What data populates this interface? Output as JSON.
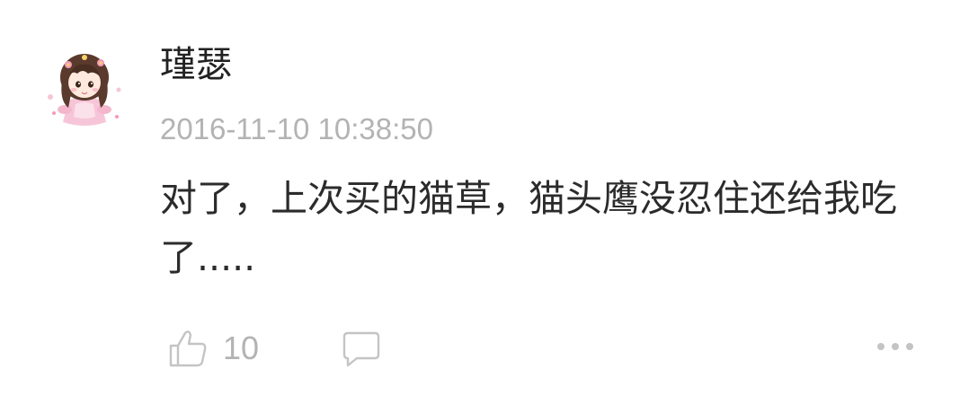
{
  "comment": {
    "avatar_icon": "cartoon-girl-avatar",
    "username": "瑾瑟",
    "timestamp": "2016-11-10 10:38:50",
    "text": "对了，上次买的猫草，猫头鹰没忍住还给我吃了....."
  },
  "actions": {
    "like_icon": "thumbs-up-icon",
    "like_count": "10",
    "reply_icon": "speech-bubble-icon",
    "more_icon": "ellipsis-icon"
  },
  "colors": {
    "text_primary": "#2b2b2b",
    "text_secondary": "#b3b3b3",
    "background": "#ffffff"
  }
}
